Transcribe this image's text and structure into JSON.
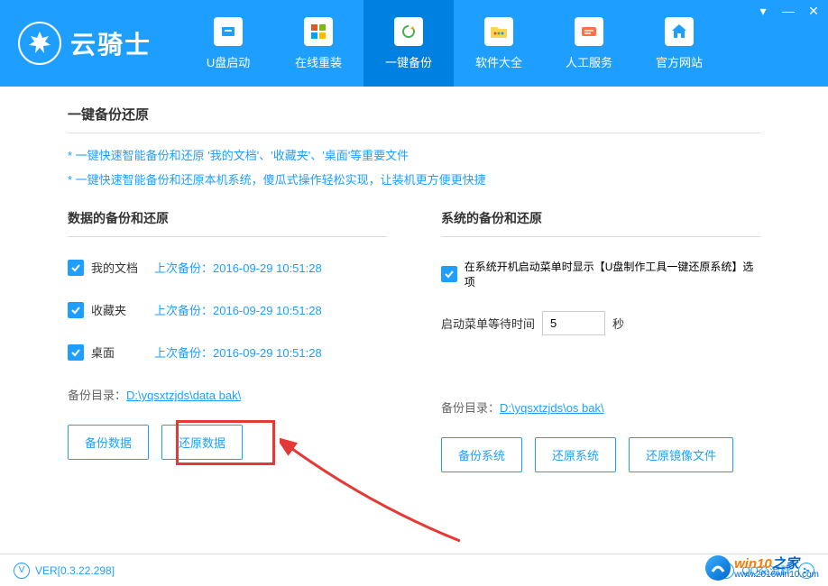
{
  "header": {
    "app_name": "云骑士",
    "tabs": [
      {
        "label": "U盘启动"
      },
      {
        "label": "在线重装"
      },
      {
        "label": "一键备份"
      },
      {
        "label": "软件大全"
      },
      {
        "label": "人工服务"
      },
      {
        "label": "官方网站"
      }
    ]
  },
  "intro": {
    "title": "一键备份还原",
    "hint1": "* 一键快速智能备份和还原 '我的文档'、'收藏夹'、'桌面'等重要文件",
    "hint2": "* 一键快速智能备份和还原本机系统，傻瓜式操作轻松实现，让装机更方便更快捷"
  },
  "data_panel": {
    "title": "数据的备份和还原",
    "items": [
      {
        "label": "我的文档",
        "info": "上次备份：2016-09-29 10:51:28"
      },
      {
        "label": "收藏夹",
        "info": "上次备份：2016-09-29 10:51:28"
      },
      {
        "label": "桌面",
        "info": "上次备份：2016-09-29 10:51:28"
      }
    ],
    "dir_label": "备份目录：",
    "dir_path": "D:\\yqsxtzjds\\data bak\\",
    "btn_backup": "备份数据",
    "btn_restore": "还原数据"
  },
  "system_panel": {
    "title": "系统的备份和还原",
    "option_label": "在系统开机启动菜单时显示【U盘制作工具一键还原系统】选项",
    "wait_label": "启动菜单等待时间",
    "wait_value": "5",
    "wait_unit": "秒",
    "dir_label": "备份目录：",
    "dir_path": "D:\\yqsxtzjds\\os bak\\",
    "btn_backup": "备份系统",
    "btn_restore": "还原系统",
    "btn_image": "还原镜像文件"
  },
  "footer": {
    "version_prefix": "V",
    "version": "VER[0.3.22.298]",
    "qq_label": "QQ交流群"
  },
  "watermark": {
    "text": "win10之家",
    "url": "www.2016win10.com"
  }
}
